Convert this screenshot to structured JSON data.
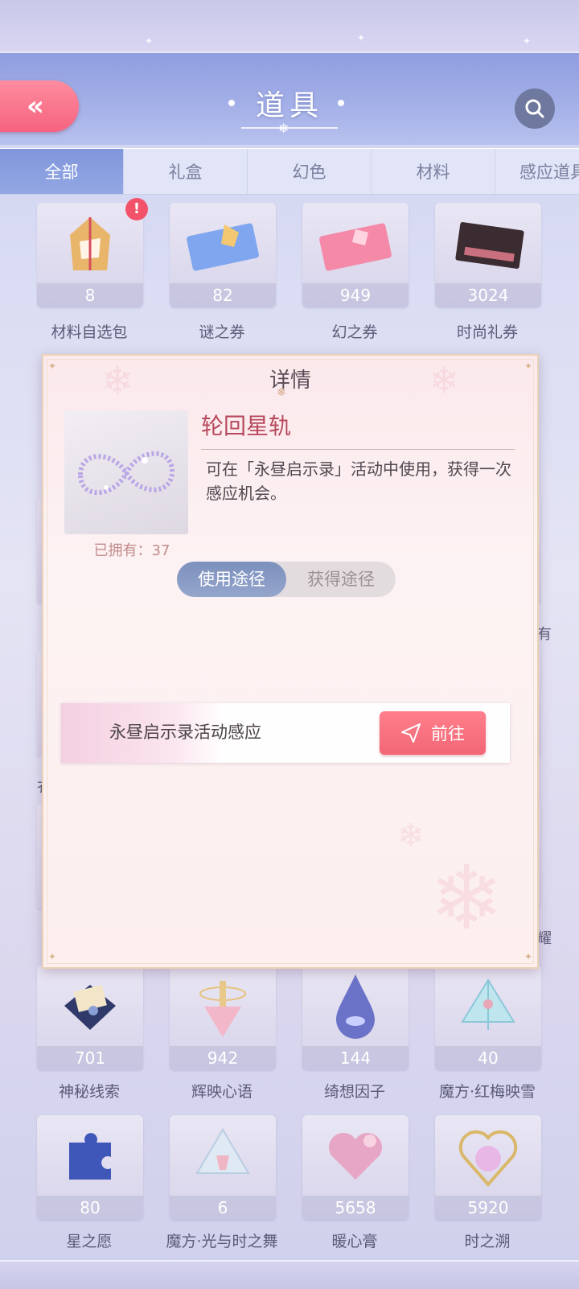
{
  "header": {
    "title": "道具"
  },
  "tabs": [
    "全部",
    "礼盒",
    "幻色",
    "材料",
    "感应道具"
  ],
  "items_top": [
    {
      "count": "8",
      "name": "材料自选包",
      "badge": "!",
      "icon": "gift-bag-icon"
    },
    {
      "count": "82",
      "name": "谜之券",
      "icon": "mystery-ticket-icon"
    },
    {
      "count": "949",
      "name": "幻之券",
      "icon": "illusion-ticket-icon"
    },
    {
      "count": "3024",
      "name": "时尚礼券",
      "icon": "fashion-voucher-icon"
    }
  ],
  "items_row5": [
    {
      "count": "701",
      "name": "神秘线索",
      "icon": "letter-envelope-icon"
    },
    {
      "count": "942",
      "name": "辉映心语",
      "icon": "spinning-top-icon"
    },
    {
      "count": "144",
      "name": "绮想因子",
      "icon": "water-drop-icon"
    },
    {
      "count": "40",
      "name": "魔方·红梅映雪",
      "icon": "crystal-pyramid-icon"
    }
  ],
  "items_row6": [
    {
      "count": "80",
      "name": "星之愿",
      "icon": "puzzle-piece-icon"
    },
    {
      "count": "6",
      "name": "魔方·光与时之舞",
      "icon": "glass-pyramid-icon"
    },
    {
      "count": "5658",
      "name": "暖心膏",
      "icon": "heart-box-icon"
    },
    {
      "count": "5920",
      "name": "时之溯",
      "icon": "heart-compact-icon"
    }
  ],
  "side_labels": {
    "right_a": "有",
    "right_b": "耀",
    "left_a": "衣"
  },
  "modal": {
    "title": "详情",
    "item_name": "轮回星轨",
    "description": "可在「永昼启示录」活动中使用，获得一次感应机会。",
    "owned": "已拥有：37",
    "seg_use": "使用途径",
    "seg_get": "获得途径",
    "route_label": "永昼启示录活动感应",
    "go_label": "前往"
  },
  "colors": {
    "accent_pink": "#f26676",
    "tab_active": "#8a9fe0",
    "item_name": "#b7485c"
  }
}
